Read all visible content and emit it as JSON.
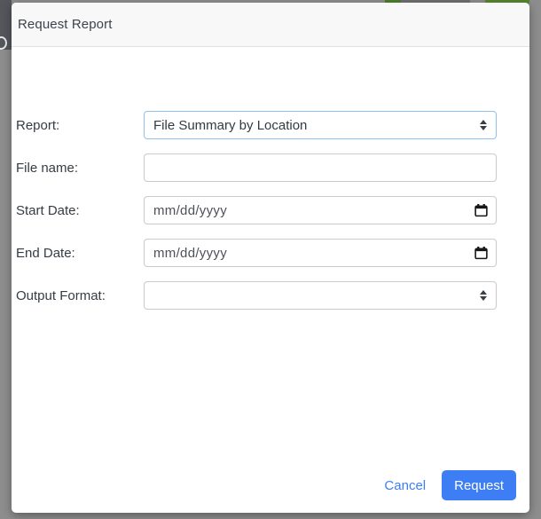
{
  "modal": {
    "title": "Request Report",
    "form": {
      "fields": [
        {
          "label": "Report:",
          "type": "select",
          "value": "File Summary by Location",
          "focused": true
        },
        {
          "label": "File name:",
          "type": "text",
          "value": ""
        },
        {
          "label": "Start Date:",
          "type": "date",
          "placeholder": "mm/dd/yyyy"
        },
        {
          "label": "End Date:",
          "type": "date",
          "placeholder": "mm/dd/yyyy"
        },
        {
          "label": "Output Format:",
          "type": "select",
          "value": ""
        }
      ]
    },
    "footer": {
      "cancel_label": "Cancel",
      "request_label": "Request"
    }
  },
  "icons": {
    "select_indicator": "up-down-arrows-icon",
    "date_picker": "calendar-icon"
  },
  "colors": {
    "accent_blue": "#3d7ef5",
    "focused_field_border": "#8fc0ef",
    "field_border": "#cbcbcb",
    "header_bg": "#f8f8f8",
    "backdrop": "#8d8d8d"
  }
}
